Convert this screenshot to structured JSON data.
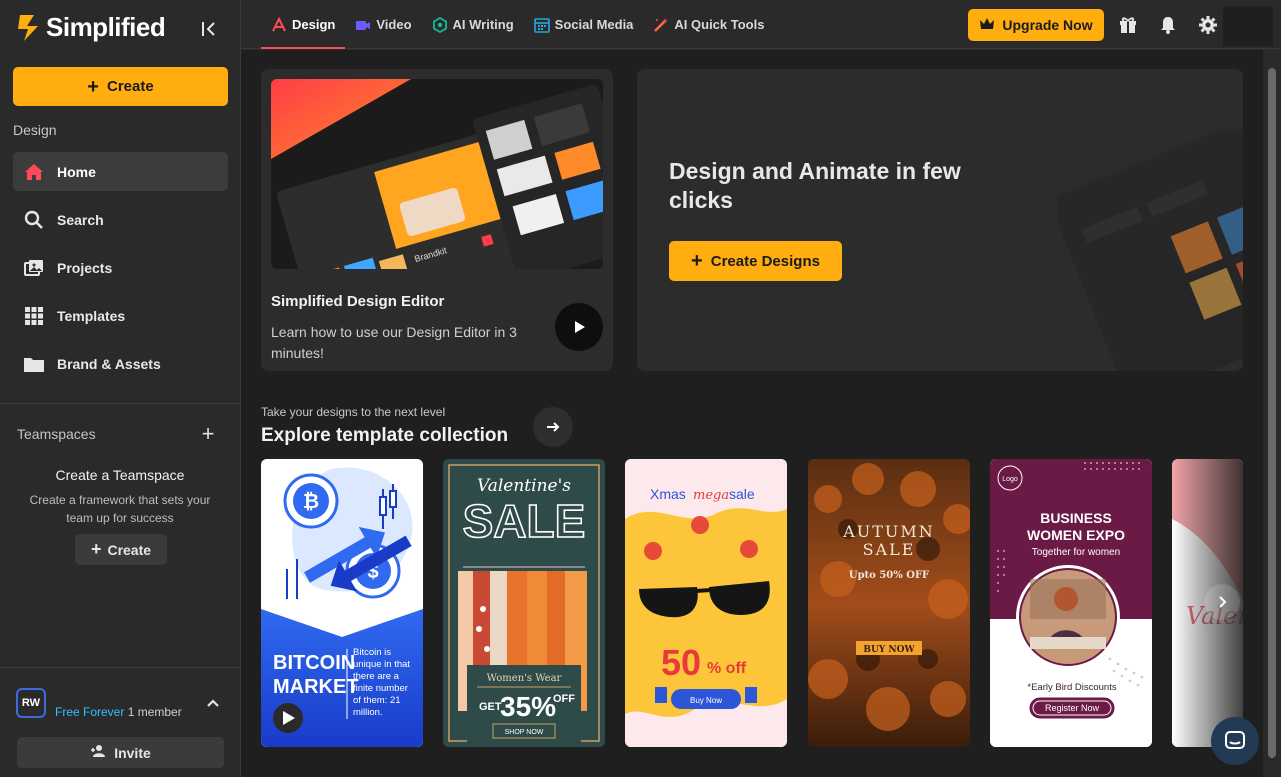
{
  "app": {
    "name": "Simplified",
    "brand_color": "#ffad0f"
  },
  "sidebar": {
    "create_label": "Create",
    "section_label": "Design",
    "items": [
      {
        "label": "Home",
        "icon": "home-icon",
        "active": true
      },
      {
        "label": "Search",
        "icon": "search-icon",
        "active": false
      },
      {
        "label": "Projects",
        "icon": "projects-icon",
        "active": false
      },
      {
        "label": "Templates",
        "icon": "templates-grid-icon",
        "active": false
      },
      {
        "label": "Brand & Assets",
        "icon": "folder-icon",
        "active": false
      }
    ],
    "teamspaces": {
      "label": "Teamspaces",
      "title": "Create a Teamspace",
      "description": "Create a framework that sets your team up for success",
      "create_label": "Create"
    },
    "user": {
      "initials": "RW",
      "plan": "Free Forever",
      "members": "1 member"
    },
    "invite_label": "Invite"
  },
  "topbar": {
    "tabs": [
      {
        "label": "Design",
        "icon": "design-icon",
        "active": true
      },
      {
        "label": "Video",
        "icon": "video-icon",
        "active": false
      },
      {
        "label": "AI Writing",
        "icon": "ai-writing-icon",
        "active": false
      },
      {
        "label": "Social Media",
        "icon": "calendar-icon",
        "active": false
      },
      {
        "label": "AI Quick Tools",
        "icon": "magic-wand-icon",
        "active": false
      }
    ],
    "upgrade_label": "Upgrade Now"
  },
  "editor_card": {
    "title": "Simplified Design Editor",
    "description": "Learn how to use our Design Editor in 3 minutes!",
    "thumb_texts": [
      "Brandkit"
    ]
  },
  "hero_card": {
    "title": "Design and Animate in few clicks",
    "button_label": "Create Designs"
  },
  "explore": {
    "subtitle": "Take your designs to the next level",
    "title": "Explore template collection"
  },
  "templates": [
    {
      "name": "bitcoin",
      "title": "BITCOIN MARKET",
      "body": "Bitcoin is unique in that there are a finite number of them: 21 million."
    },
    {
      "name": "valentines",
      "title": "Valentine's",
      "title2": "SALE",
      "tag": "Women's Wear",
      "offer": "GET",
      "percent": "35%",
      "off": "OFF",
      "cta": "SHOP NOW"
    },
    {
      "name": "xmas",
      "title": "Xmas",
      "title_mid": "mega",
      "title_end": "sale",
      "percent": "50",
      "off": "% off",
      "cta": "Buy Now"
    },
    {
      "name": "autumn",
      "title": "AUTUMN",
      "title2": "SALE",
      "offer": "Upto 50% OFF",
      "cta": "BUY NOW"
    },
    {
      "name": "business-expo",
      "logo": "Logo",
      "title": "BUSINESS",
      "title2": "WOMEN EXPO",
      "subtitle": "Together for women",
      "discount": "*Early Bird Discounts",
      "cta": "Register Now"
    },
    {
      "name": "valentine-partial",
      "title": "Valen"
    }
  ]
}
